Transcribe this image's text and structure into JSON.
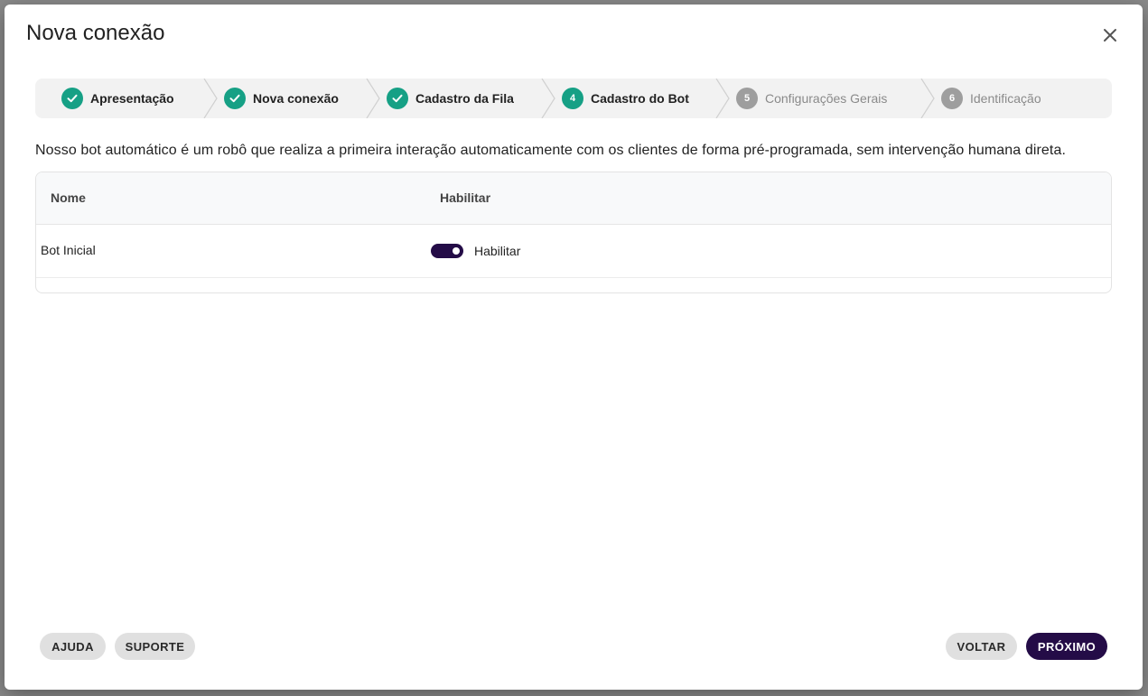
{
  "dialog": {
    "title": "Nova conexão",
    "close_icon": "close-icon"
  },
  "stepper": {
    "steps": [
      {
        "number": "1",
        "label": "Apresentação",
        "state": "done"
      },
      {
        "number": "2",
        "label": "Nova conexão",
        "state": "done"
      },
      {
        "number": "3",
        "label": "Cadastro da Fila",
        "state": "done"
      },
      {
        "number": "4",
        "label": "Cadastro do Bot",
        "state": "active"
      },
      {
        "number": "5",
        "label": "Configurações Gerais",
        "state": "pending"
      },
      {
        "number": "6",
        "label": "Identificação",
        "state": "pending"
      }
    ]
  },
  "description": "Nosso bot automático é um robô que realiza a primeira interação automaticamente com os clientes de forma pré-programada, sem intervenção humana direta.",
  "table": {
    "headers": {
      "name": "Nome",
      "enable": "Habilitar"
    },
    "rows": [
      {
        "name": "Bot Inicial",
        "toggle_label": "Habilitar",
        "enabled": true
      }
    ]
  },
  "footer": {
    "help": "AJUDA",
    "support": "SUPORTE",
    "back": "VOLTAR",
    "next": "PRÓXIMO"
  },
  "colors": {
    "accent": "#16a085",
    "primary": "#240c47",
    "pending": "#9e9e9e"
  }
}
